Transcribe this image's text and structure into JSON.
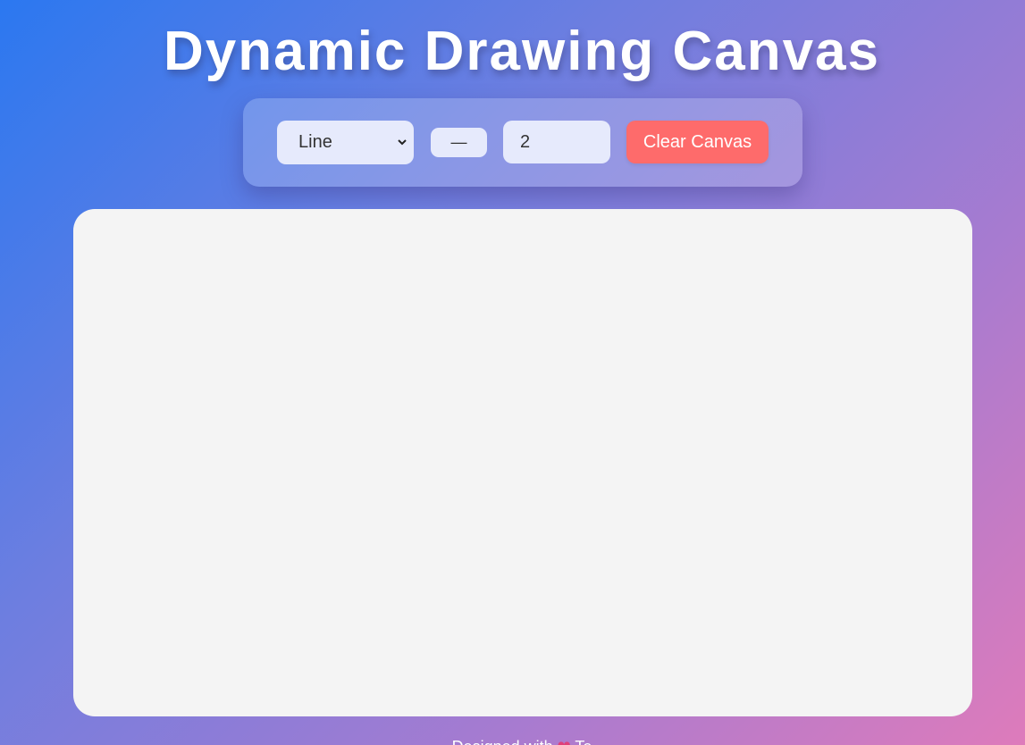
{
  "header": {
    "title": "Dynamic Drawing Canvas"
  },
  "toolbar": {
    "shape_select": {
      "selected": "Line"
    },
    "color_button_label": "—",
    "width_input_value": "2",
    "clear_button_label": "Clear Canvas"
  },
  "footer": {
    "text_before": "Designed with ",
    "heart": "❤",
    "text_after": " Te"
  },
  "icons": {
    "select_arrow": "chevron-down-icon",
    "footer_heart": "heart-icon"
  },
  "colors": {
    "clear_button": "#fe6b6b",
    "canvas_background": "#f4f4f4",
    "control_background": "#e6eafc"
  }
}
